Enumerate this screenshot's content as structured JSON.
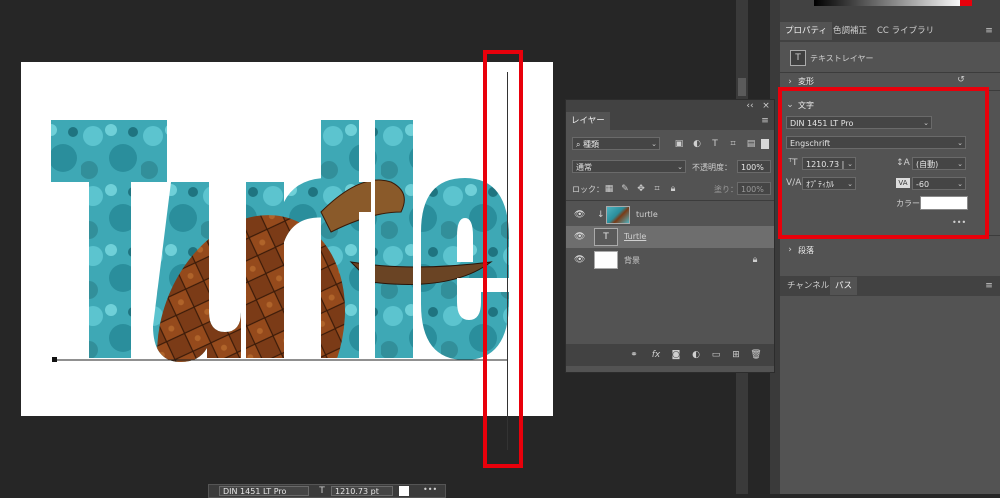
{
  "canvas": {
    "word": "Turtle",
    "colors": {
      "water": "#4fb3c0",
      "shell": "#7a3a16",
      "paper": "#ffffff"
    }
  },
  "layers_panel": {
    "tab": "レイヤー",
    "filter": "種類",
    "blend_mode": "通常",
    "opacity_label": "不透明度：",
    "opacity_value": "100%",
    "lock_label": "ロック：",
    "fill_label": "塗り：",
    "fill_value": "100%",
    "layers": [
      {
        "name": "turtle",
        "type": "image",
        "selected": false
      },
      {
        "name": "Turtle",
        "type": "text",
        "selected": true
      },
      {
        "name": "背景",
        "type": "background",
        "selected": false
      }
    ]
  },
  "properties_panel": {
    "tabs": [
      "プロパティ",
      "色調補正",
      "CC ライブラリ"
    ],
    "layer_type": "テキストレイヤー",
    "transform_section": "変形",
    "character_section": "文字",
    "font_family": "DIN 1451 LT Pro",
    "font_style": "Engschrift",
    "font_size": "1210.73 |",
    "leading": "(自動)",
    "kerning": "ｵﾌﾟﾃｨｶﾙ",
    "tracking": "-60",
    "color_label": "カラー",
    "color_value": "#ffffff",
    "more": "•••",
    "paragraph_section": "段落"
  },
  "lower_panel": {
    "tabs": [
      "チャンネル",
      "パス"
    ]
  },
  "bottom_bar": {
    "font_family": "DIN 1451 LT Pro",
    "font_size": "1210.73 pt",
    "more": "•••"
  }
}
